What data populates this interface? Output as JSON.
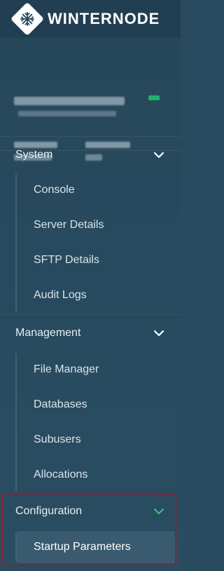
{
  "brand": {
    "name_part1": "WINTER",
    "name_part2": "NODE",
    "logo_icon": "snowflake-icon"
  },
  "profile": {
    "status_color": "#1cb46a"
  },
  "sections": [
    {
      "label": "System",
      "expanded": true,
      "items": [
        {
          "label": "Console"
        },
        {
          "label": "Server Details"
        },
        {
          "label": "SFTP Details"
        },
        {
          "label": "Audit Logs"
        }
      ]
    },
    {
      "label": "Management",
      "expanded": true,
      "items": [
        {
          "label": "File Manager"
        },
        {
          "label": "Databases"
        },
        {
          "label": "Subusers"
        },
        {
          "label": "Allocations"
        }
      ]
    },
    {
      "label": "Configuration",
      "expanded": true,
      "items": [
        {
          "label": "Startup Parameters",
          "active": true
        }
      ]
    }
  ],
  "colors": {
    "background": "#294a5f",
    "active_item": "#3a5b6f",
    "chevron_default": "#ffffff",
    "chevron_active": "#38c172",
    "highlight_border": "#8f1f2e"
  }
}
